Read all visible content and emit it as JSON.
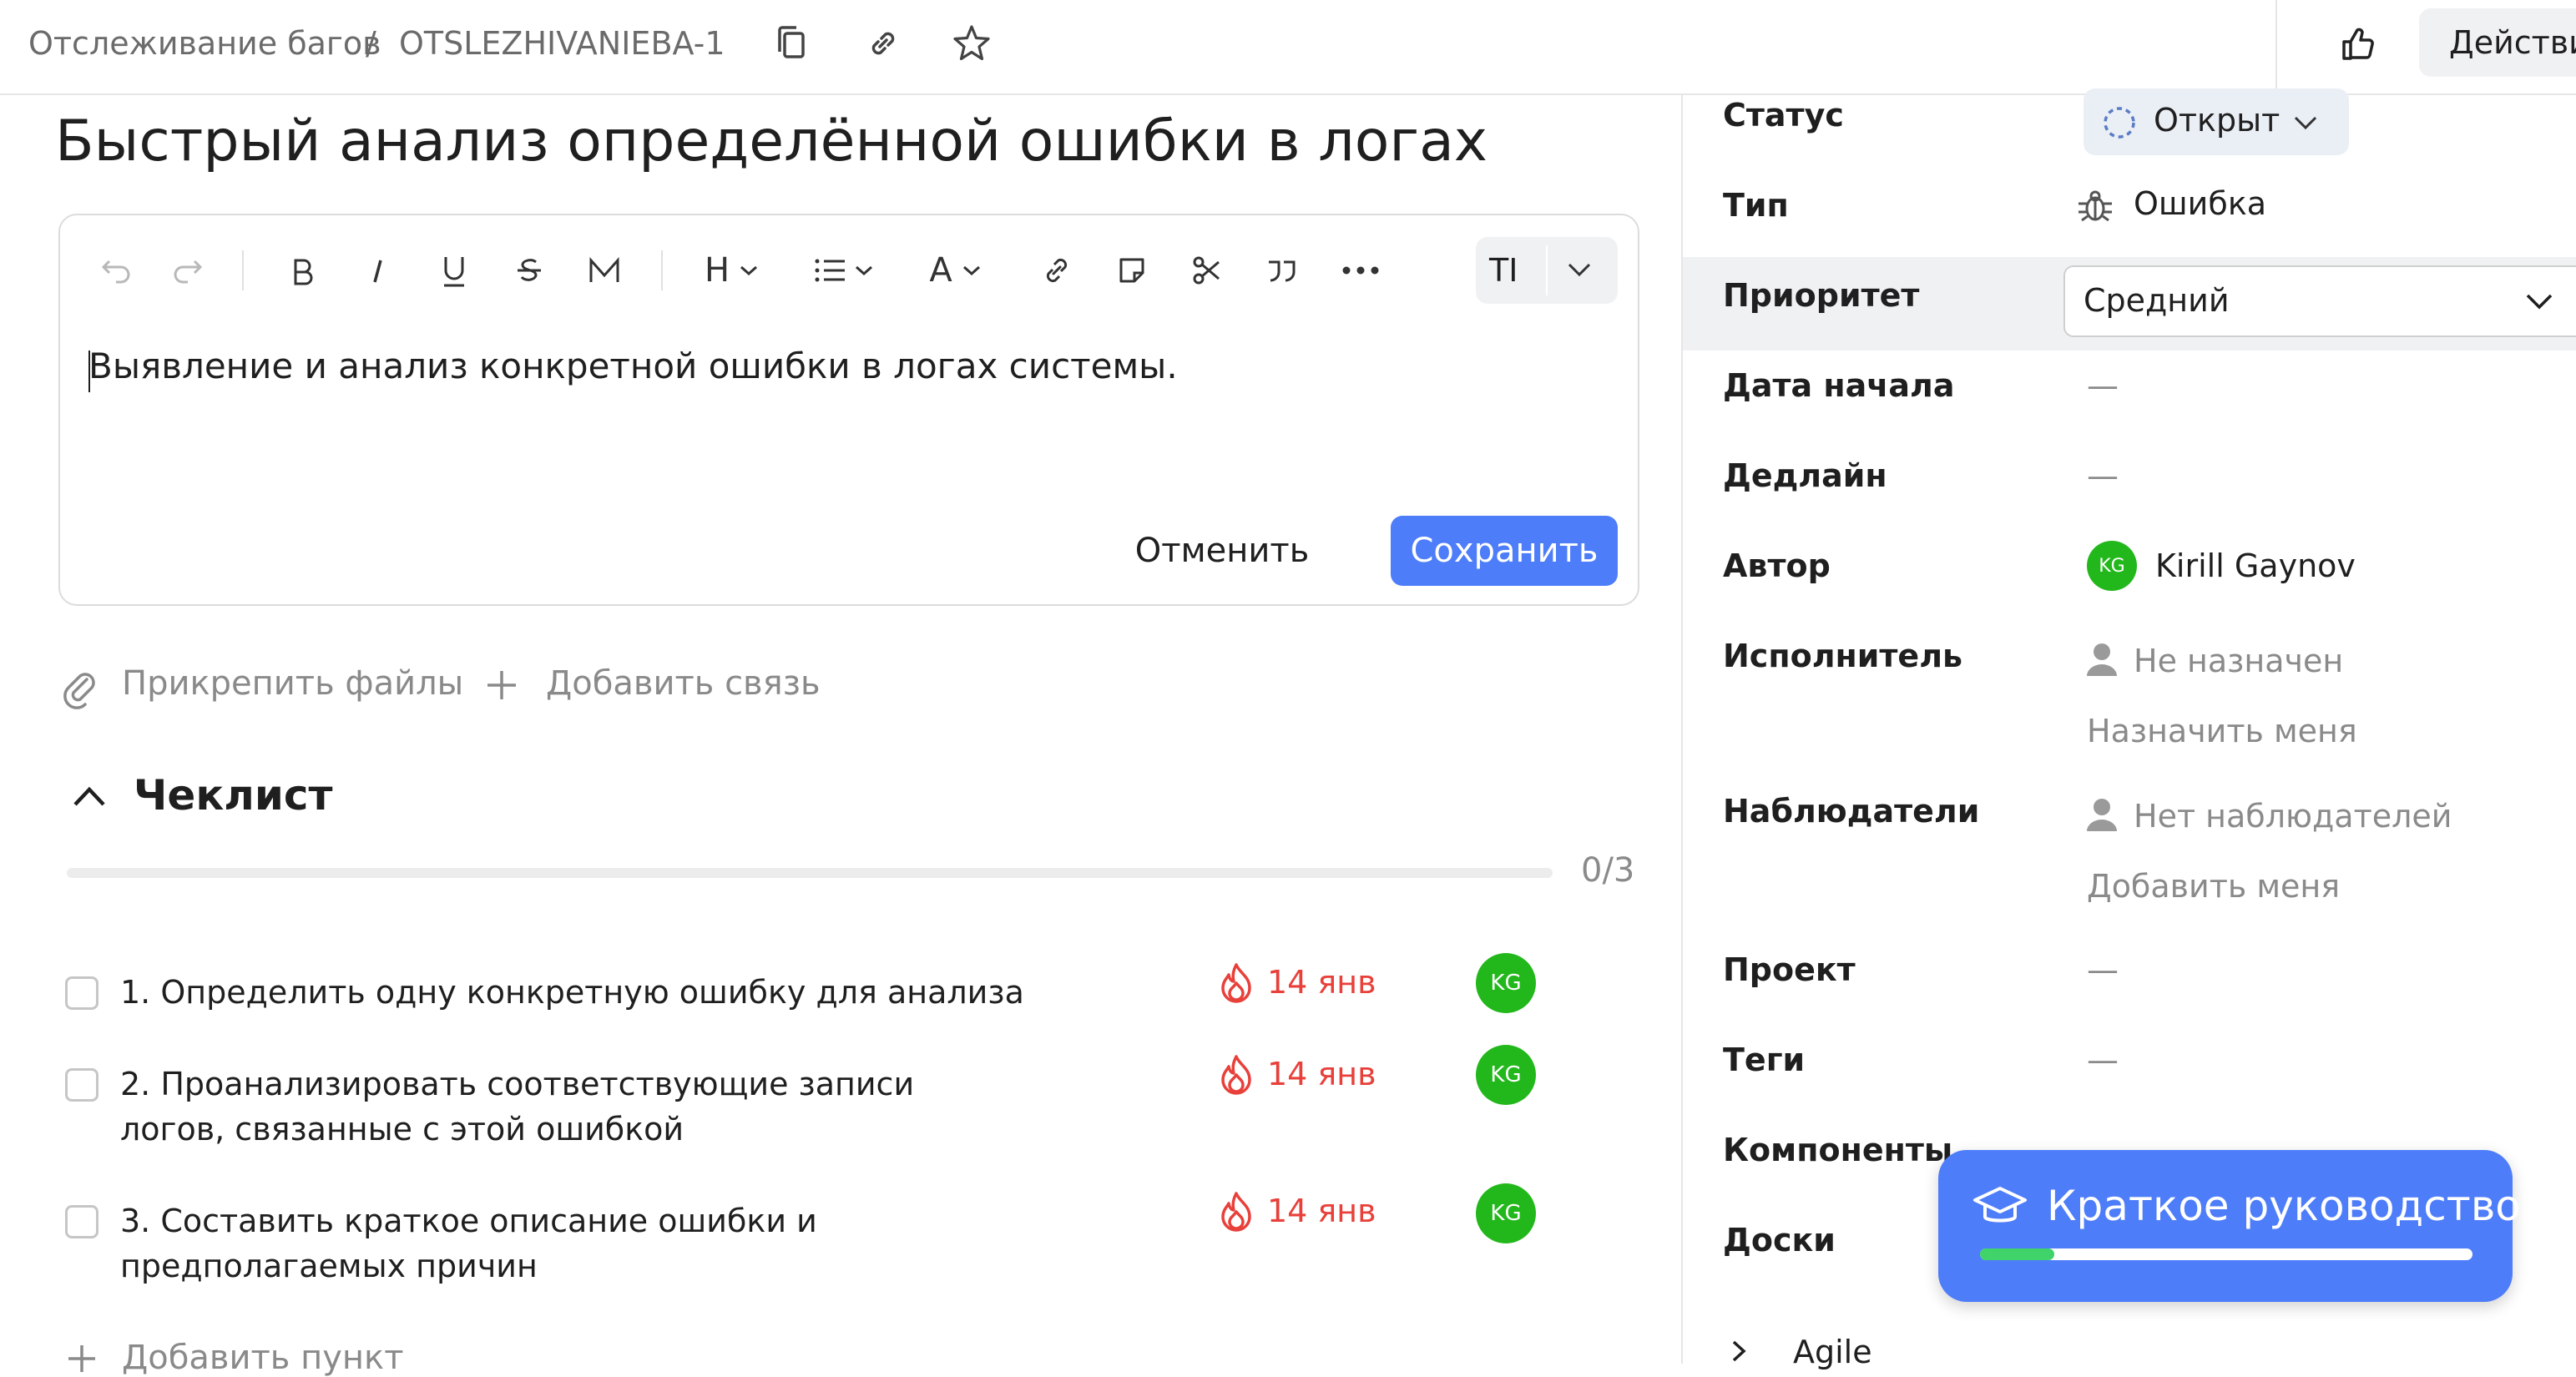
{
  "header": {
    "breadcrumb_queue": "Отслеживание багов",
    "breadcrumb_sep": "/",
    "breadcrumb_key": "OTSLEZHIVANIEBA-1",
    "actions_label": "Действия"
  },
  "issue": {
    "title": "Быстрый анализ определённой ошибки в логах"
  },
  "editor": {
    "text": "Выявление и анализ конкретной ошибки в логах системы.",
    "cancel_label": "Отменить",
    "save_label": "Сохранить",
    "toolbar": {
      "heading": "H",
      "text_color": "A",
      "mode": "TI"
    }
  },
  "links": {
    "attach_label": "Прикрепить файлы",
    "add_link_label": "Добавить связь"
  },
  "checklist": {
    "title": "Чеклист",
    "progress_label": "0/3",
    "progress": 0,
    "items": [
      {
        "text": "1. Определить одну конкретную ошибку для анализа",
        "due": "14 янв",
        "assignee_initials": "KG"
      },
      {
        "text": "2. Проанализировать соответствующие записи логов, связанные с этой ошибкой",
        "due": "14 янв",
        "assignee_initials": "KG"
      },
      {
        "text": "3. Составить краткое описание ошибки и предполагаемых причин",
        "due": "14 янв",
        "assignee_initials": "KG"
      }
    ],
    "add_item_label": "Добавить пункт"
  },
  "properties": {
    "status": {
      "label": "Статус",
      "value": "Открыт"
    },
    "type": {
      "label": "Тип",
      "value": "Ошибка"
    },
    "priority": {
      "label": "Приоритет",
      "value": "Средний"
    },
    "start_date": {
      "label": "Дата начала",
      "value": "—"
    },
    "deadline": {
      "label": "Дедлайн",
      "value": "—"
    },
    "author": {
      "label": "Автор",
      "value": "Kirill Gaynov",
      "initials": "KG"
    },
    "assignee": {
      "label": "Исполнитель",
      "value": "Не назначен",
      "action": "Назначить меня"
    },
    "followers": {
      "label": "Наблюдатели",
      "value": "Нет наблюдателей",
      "action": "Добавить меня"
    },
    "project": {
      "label": "Проект",
      "value": "—"
    },
    "tags": {
      "label": "Теги",
      "value": "—"
    },
    "components": {
      "label": "Компоненты"
    },
    "boards": {
      "label": "Доски"
    },
    "agile": {
      "label": "Agile"
    }
  },
  "guide": {
    "label": "Краткое руководство",
    "progress": 0.15
  },
  "colors": {
    "accent": "#4e7dfa",
    "danger": "#e8403a",
    "avatar": "#22b81b",
    "progress_fill": "#3fd36a"
  }
}
